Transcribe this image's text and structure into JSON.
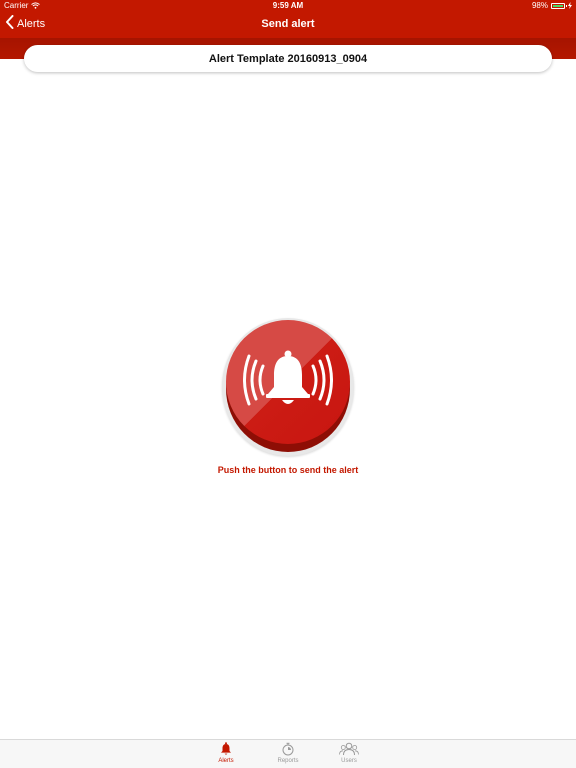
{
  "status_bar": {
    "carrier": "Carrier",
    "time": "9:59 AM",
    "battery": "98%",
    "battery_level": 0.98,
    "wifi_icon": "wifi-icon",
    "charge_icon": "charge-icon"
  },
  "nav": {
    "back_label": "Alerts",
    "title": "Send alert",
    "back_icon": "chevron-left-icon"
  },
  "template": {
    "name": "Alert Template 20160913_0904"
  },
  "alert_button": {
    "icon": "bell-ringing-icon",
    "caption": "Push the button to send the alert"
  },
  "tabs": [
    {
      "label": "Alerts",
      "icon": "bell-icon",
      "active": true
    },
    {
      "label": "Reports",
      "icon": "stopwatch-icon",
      "active": false
    },
    {
      "label": "Users",
      "icon": "users-icon",
      "active": false
    }
  ],
  "colors": {
    "brand": "#c31800",
    "band": "#a61400",
    "button_face": "#cc1c14",
    "inactive_tab": "#999999"
  }
}
